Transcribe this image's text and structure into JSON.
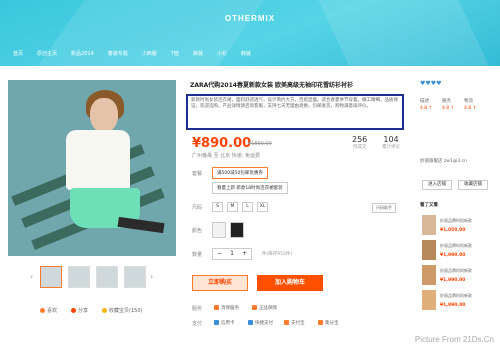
{
  "brand": "OTHERMIX",
  "nav": [
    "首页",
    "原创主页",
    "新品2014",
    "春装专题",
    "小西服",
    "T恤",
    "裤装",
    "小衫",
    "韩装"
  ],
  "product": {
    "title": "ZARA代购2014春夏新款女装 欧美高级无袖印花雪纺衫衬衫",
    "description": "新款时尚女装连衣裙，面料舒适透气，设计简约大方，百搭显瘦。适合春夏季节穿着，做工精细，品质保证，欢迎选购。产品详情请咨询客服，支持七天无理由退换，包邮发货，购物满意再评价。",
    "price": "¥890.00",
    "old_price": "¥1890.00",
    "sold_count": "256",
    "sold_label": "月成交",
    "review_count": "104",
    "review_label": "累计评论",
    "shipping": "广州番禺  至  北京 快递: 免运费",
    "version_label": "套餐",
    "versions": [
      "满500减50包邮优惠券",
      "春夏上新 新款18时尚连衣裙套装"
    ],
    "size_label": "尺码",
    "sizes": [
      "S",
      "M",
      "L",
      "XL"
    ],
    "size_chart": "尺码助手",
    "color_label": "颜色",
    "qty_label": "数量",
    "qty": "1",
    "stock": "件(库存955件)",
    "buy_label": "立即购买",
    "cart_label": "加入购物车",
    "service_label": "服务",
    "pay_label": "支付",
    "services": [
      "消保服务",
      "正品保障"
    ],
    "payments": [
      "信用卡",
      "快捷支付",
      "支付宝",
      "集分宝"
    ]
  },
  "gallery": {
    "share": [
      "喜欢",
      "分享",
      "收藏宝贝(150)"
    ]
  },
  "side": {
    "ratings": [
      "4.8 ↑",
      "4.8 ↑",
      "4.8 ↑"
    ],
    "rating_labels": [
      "描述",
      "服务",
      "物流"
    ],
    "shop_links": [
      "进入店铺",
      "收藏店铺"
    ],
    "recommend_title": "看了又看",
    "items": [
      {
        "name": "妙丽品牌时尚新款",
        "price": "¥1,050.00"
      },
      {
        "name": "妙丽品牌时尚新款",
        "price": "¥1,990.00"
      },
      {
        "name": "妙丽品牌时尚新款",
        "price": "¥1,990.00"
      },
      {
        "name": "妙丽品牌时尚新款",
        "price": "¥1,990.00"
      }
    ],
    "shop_name": "妙丽旗舰店 zw1@3.cn"
  },
  "watermark": "Picture From 21Ds.Cn",
  "colors": {
    "accent": "#ff5000",
    "header": "#39c7dd",
    "highlight": "#1d2f8f"
  }
}
